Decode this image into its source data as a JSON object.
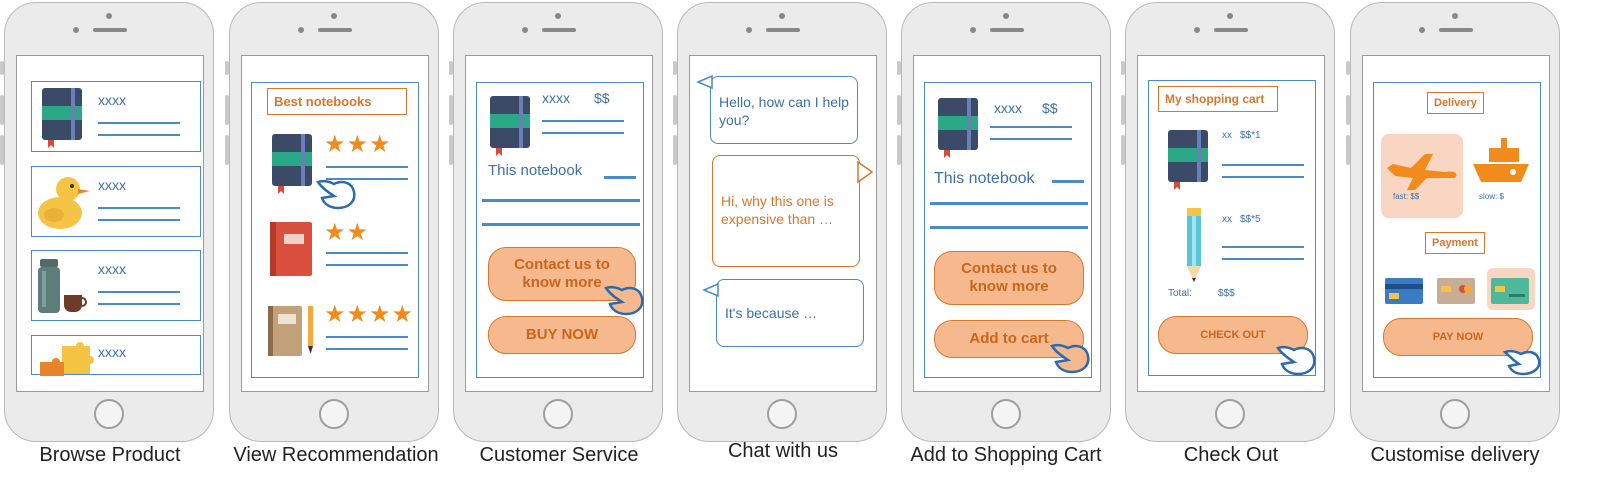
{
  "captions": [
    "Browse Product",
    "View Recommendation",
    "Customer Service",
    "Chat with us",
    "Add to Shopping Cart",
    "Check Out",
    "Customise delivery"
  ],
  "browse": {
    "items": [
      "xxxx",
      "xxxx",
      "xxxx",
      "xxxx"
    ]
  },
  "recommend": {
    "title": "Best notebooks",
    "stars": [
      "★★★",
      "★★",
      "★★★★"
    ]
  },
  "service": {
    "name": "xxxx",
    "price": "$$",
    "desc": "This notebook",
    "contact": "Contact us to know more",
    "buy": "BUY NOW"
  },
  "chat": {
    "msg1": "Hello, how can I help you?",
    "msg2": "Hi, why this one is expensive than …",
    "msg3": "It's because …"
  },
  "cart": {
    "name": "xxxx",
    "price": "$$",
    "desc": "This notebook",
    "contact": "Contact us to know more",
    "add": "Add to cart"
  },
  "checkout": {
    "title": "My shopping cart",
    "item1_qty": "xx",
    "item1_price": "$$*1",
    "item2_qty": "xx",
    "item2_price": "$$*5",
    "total_label": "Total:",
    "total_value": "$$$",
    "button": "CHECK OUT"
  },
  "delivery": {
    "title": "Delivery",
    "fast": "fast: $$",
    "slow": "slow: $",
    "payment_title": "Payment",
    "button": "PAY NOW"
  },
  "colors": {
    "accent_blue": "#4a8ac8",
    "accent_orange": "#d8762e",
    "button_fill": "#f6b98e"
  }
}
